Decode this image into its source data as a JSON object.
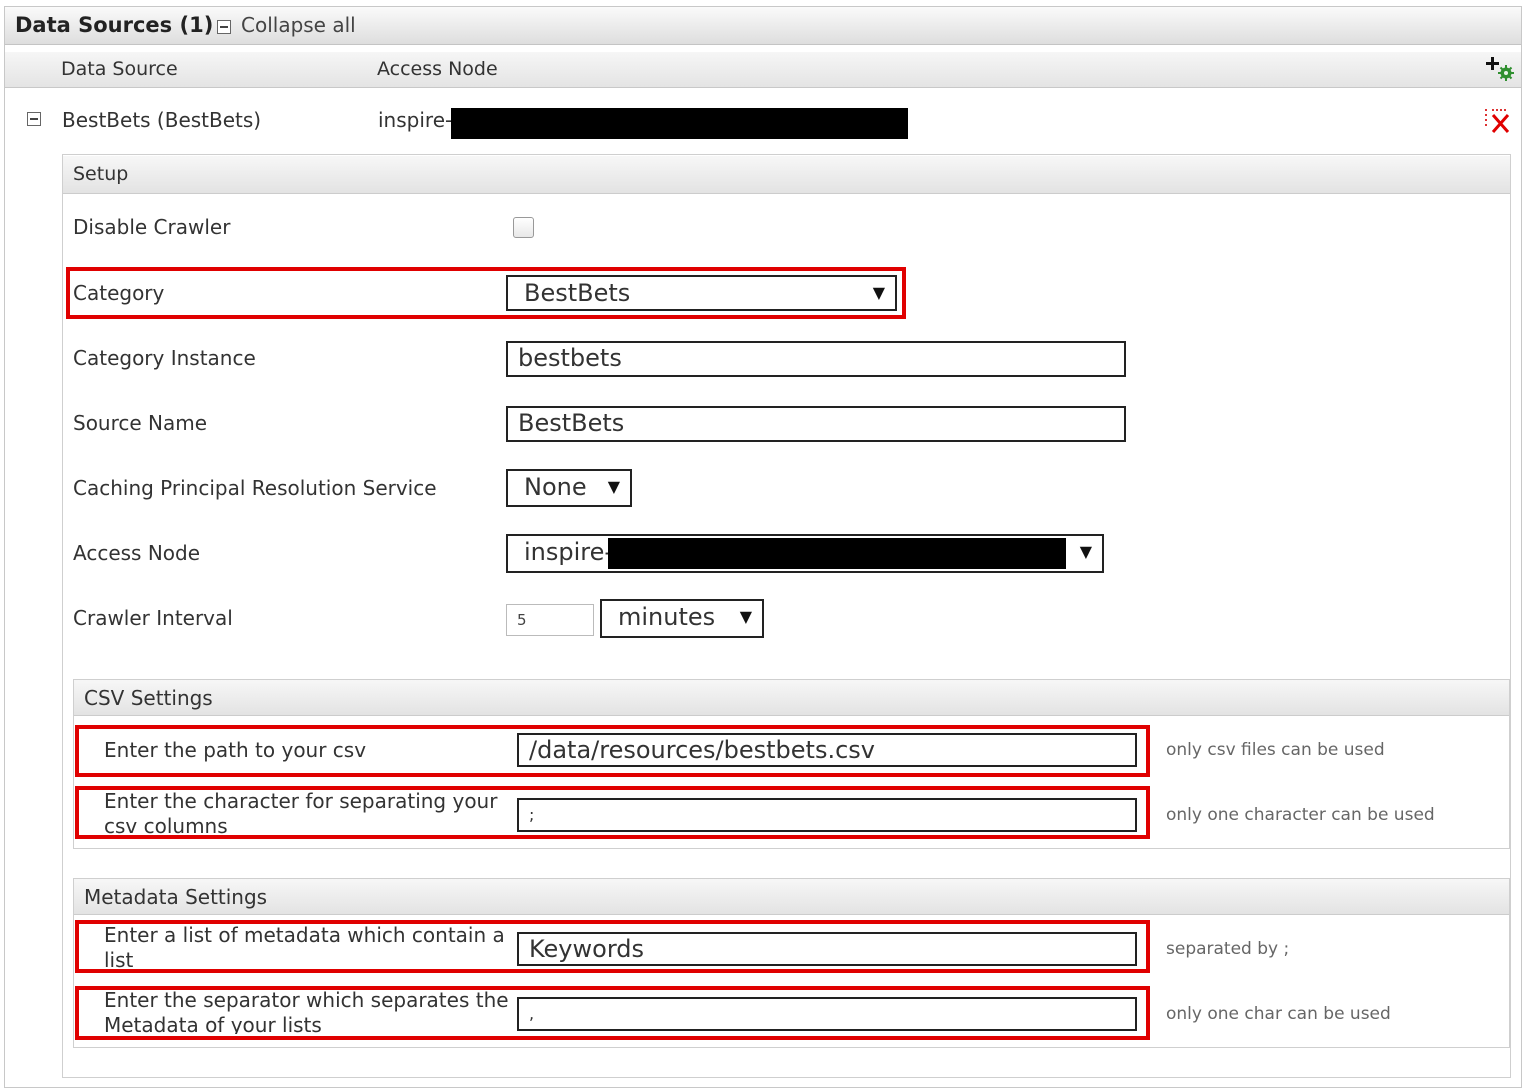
{
  "toolbar": {
    "title": "Data Sources (1)",
    "collapse_all": "Collapse all"
  },
  "columns": {
    "data_source": "Data Source",
    "access_node": "Access Node"
  },
  "source_row": {
    "name": "BestBets (BestBets)",
    "access_node_prefix": "inspire-"
  },
  "setup": {
    "heading": "Setup",
    "disable_crawler_label": "Disable Crawler",
    "disable_crawler_checked": false,
    "category_label": "Category",
    "category_value": "BestBets",
    "category_instance_label": "Category Instance",
    "category_instance_value": "bestbets",
    "source_name_label": "Source Name",
    "source_name_value": "BestBets",
    "caching_label": "Caching Principal Resolution Service",
    "caching_value": "None",
    "access_node_label": "Access Node",
    "access_node_value": "inspire-",
    "crawler_interval_label": "Crawler Interval",
    "crawler_interval_value": "5",
    "crawler_interval_unit": "minutes"
  },
  "csv": {
    "heading": "CSV Settings",
    "path_label": "Enter the path to your csv",
    "path_value": "/data/resources/bestbets.csv",
    "path_hint": "only csv files can be used",
    "sep_label": "Enter the character for separating your csv columns",
    "sep_value": ";",
    "sep_hint": "only one character can be used"
  },
  "metadata": {
    "heading": "Metadata Settings",
    "list_label": "Enter a list of metadata which contain a list",
    "list_value": "Keywords",
    "list_hint": "separated by ;",
    "sep_label": "Enter the separator which separates the Metadata of your lists",
    "sep_value": ",",
    "sep_hint": "only one char can be used"
  },
  "colors": {
    "highlight": "#e00000",
    "redaction": "#000000"
  },
  "icons": {
    "add": "add-data-source-icon",
    "delete": "delete-data-source-icon",
    "collapse": "collapse-icon"
  }
}
